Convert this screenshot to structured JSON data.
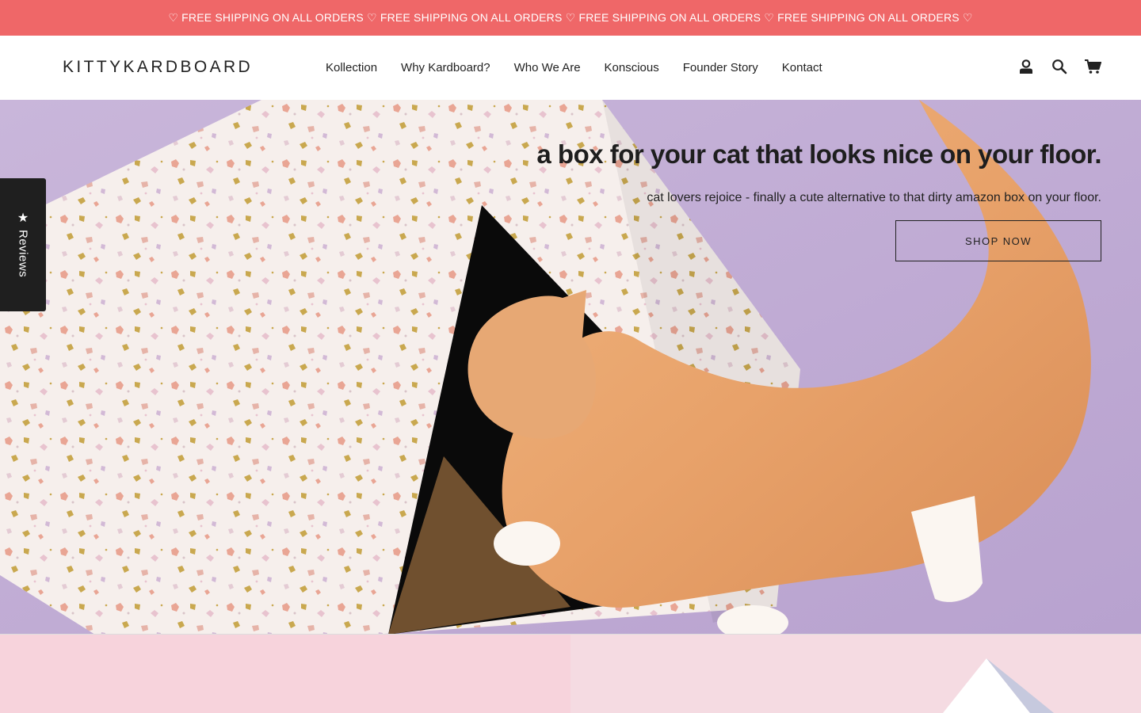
{
  "announcement": {
    "text": "♡ FREE SHIPPING ON ALL ORDERS ♡ FREE SHIPPING ON ALL ORDERS ♡ FREE SHIPPING ON ALL ORDERS ♡ FREE SHIPPING ON ALL ORDERS ♡"
  },
  "header": {
    "logo": "KITTYKARDBOARD",
    "nav": [
      "Kollection",
      "Why Kardboard?",
      "Who We Are",
      "Konscious",
      "Founder Story",
      "Kontact"
    ],
    "icons": [
      "account-icon",
      "search-icon",
      "cart-icon"
    ]
  },
  "hero": {
    "title": "a box for your cat that looks nice on your floor.",
    "subtitle": "cat lovers rejoice - finally a cute alternative to that dirty amazon box on your floor.",
    "cta": "SHOP NOW"
  },
  "reviews_tab": {
    "label": "Reviews",
    "icon": "star-icon"
  },
  "colors": {
    "announcement_bg": "#ef6768",
    "hero_bg": "#c7b2d8",
    "next_section_bg": "#f7d5dd"
  }
}
